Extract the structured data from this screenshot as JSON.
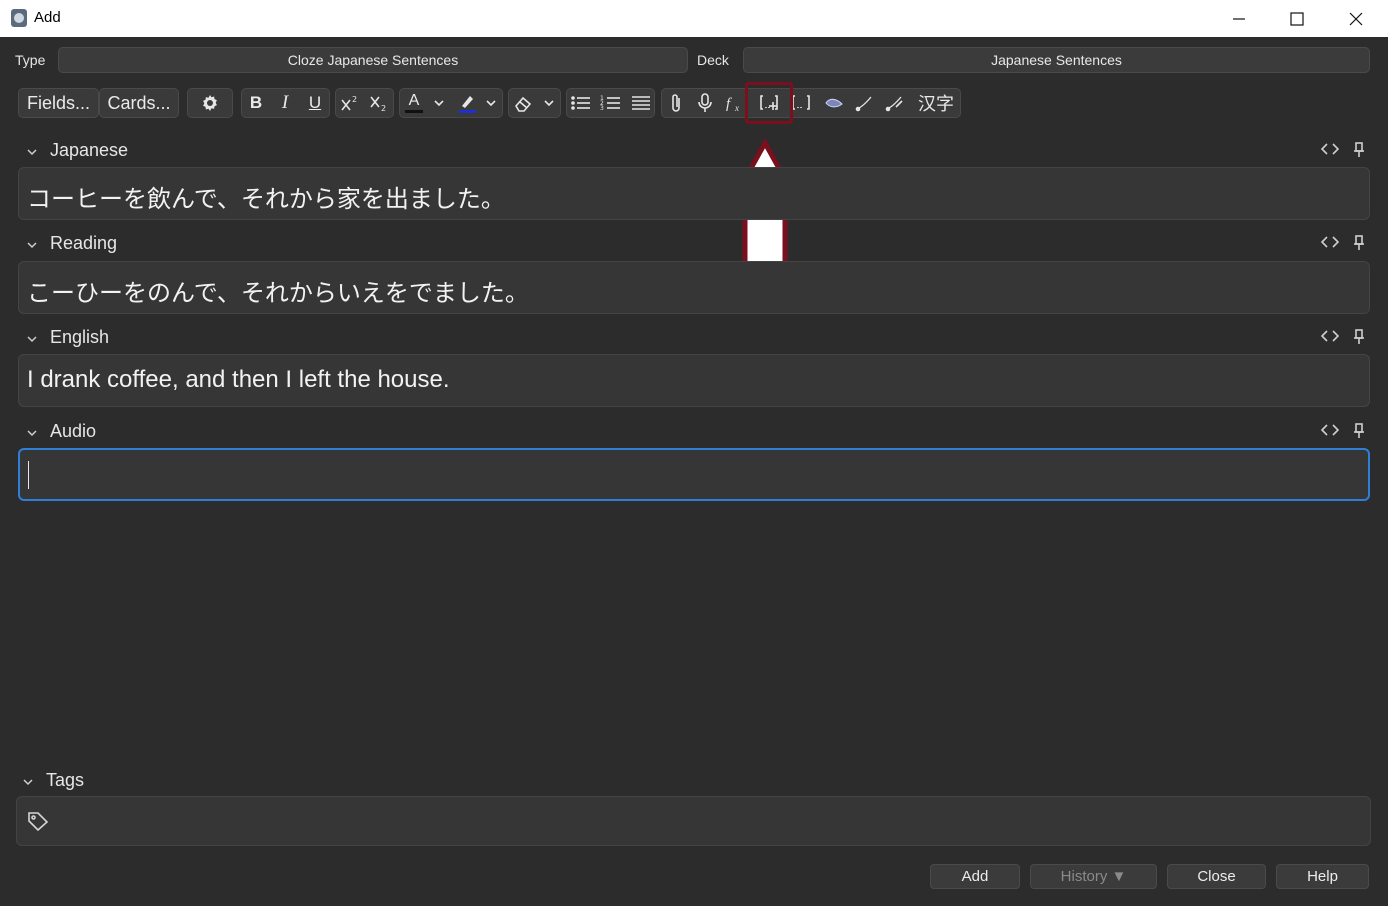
{
  "window": {
    "title": "Add"
  },
  "top": {
    "type_label": "Type",
    "type_value": "Cloze Japanese Sentences",
    "deck_label": "Deck",
    "deck_value": "Japanese Sentences"
  },
  "toolbar": {
    "fields_label": "Fields...",
    "cards_label": "Cards...",
    "bold": "B",
    "italic": "I",
    "underline": "U",
    "text_color": "A",
    "kanji_label": "汉字"
  },
  "fields": [
    {
      "name": "Japanese",
      "value": "コーヒーを飲んで、それから家を出ました。"
    },
    {
      "name": "Reading",
      "value": "こーひーをのんで、それからいえをでました。"
    },
    {
      "name": "English",
      "value": "I drank coffee, and then I left the house."
    },
    {
      "name": "Audio",
      "value": ""
    }
  ],
  "tags": {
    "label": "Tags"
  },
  "buttons": {
    "add": "Add",
    "history": "History ▼",
    "close": "Close",
    "help": "Help"
  },
  "colors": {
    "background": "#2c2c2c",
    "focus_border": "#2f7fd8",
    "highlight_annotation": "#7a0f1e",
    "highlight_swatch": "#1e2fd6"
  }
}
